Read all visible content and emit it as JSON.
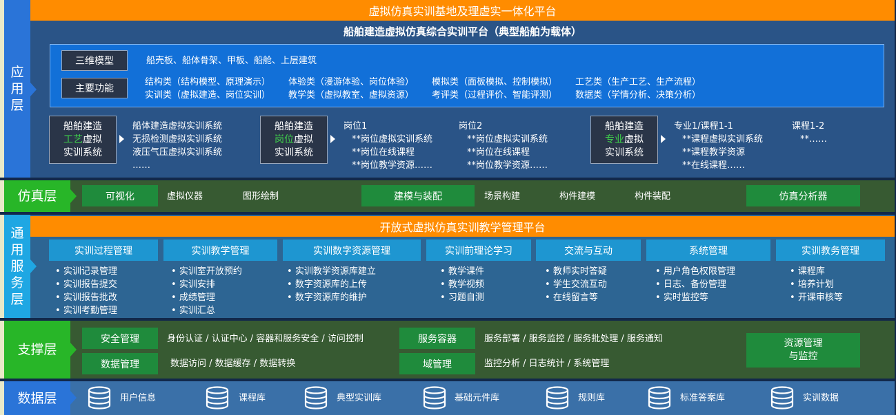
{
  "top_title": "虚拟仿真实训基地及理虚实一体化平台",
  "app_layer": {
    "side_label": "应\n用\n层",
    "subtitle": "船舶建造虚拟仿真综合实训平台（典型船舶为载体）",
    "model_label": "三维模型",
    "model_text": "船壳板、船体骨架、甲板、船舱、上层建筑",
    "func_label": "主要功能",
    "func_lines": [
      [
        "结构类（结构模型、原理演示）",
        "体验类（漫游体验、岗位体验）",
        "模拟类（面板模拟、控制模拟）",
        "工艺类（生产工艺、生产流程）"
      ],
      [
        "实训类（虚拟建造、岗位实训）",
        "教学类（虚拟教室、虚拟资源）",
        "考评类（过程评价、智能评测）",
        "数据类（学情分析、决策分析）"
      ]
    ],
    "systems": [
      {
        "l1": "船舶建造",
        "l2a": "工艺",
        "l2b": "虚拟",
        "l3": "实训系统",
        "items": [
          "船体建造虚拟实训系统",
          "无损检测虚拟实训系统",
          "液压气压虚拟实训系统",
          "……"
        ]
      },
      {
        "l1": "船舶建造",
        "l2a": "岗位",
        "l2b": "虚拟",
        "l3": "实训系统",
        "col1": [
          "岗位1",
          "**岗位虚拟实训系统",
          "**岗位在线课程",
          "**岗位教学资源……"
        ],
        "col2": [
          "岗位2",
          "**岗位虚拟实训系统",
          "**岗位在线课程",
          "**岗位教学资源……"
        ]
      },
      {
        "l1": "船舶建造",
        "l2a": "专业",
        "l2b": "虚拟",
        "l3": "实训系统",
        "col1": [
          "专业1/课程1-1",
          "**课程虚拟实训系统",
          "**课程教学资源",
          "**在线课程……"
        ],
        "col2": [
          "课程1-2",
          "**……"
        ]
      }
    ]
  },
  "sim_layer": {
    "side_label": "仿真层",
    "boxes": [
      "可视化",
      "建模与装配",
      "仿真分析器"
    ],
    "texts": [
      "虚拟仪器",
      "图形绘制",
      "场景构建",
      "构件建模",
      "构件装配"
    ]
  },
  "service_layer": {
    "side_label": "通\n用\n服\n务\n层",
    "title": "开放式虚拟仿真实训教学管理平台",
    "modules": [
      {
        "name": "实训过程管理",
        "items": [
          "实训记录管理",
          "实训报告提交",
          "实训报告批改",
          "实训考勤管理"
        ]
      },
      {
        "name": "实训教学管理",
        "items": [
          "实训室开放预约",
          "实训安排",
          "成绩管理",
          "实训汇总"
        ]
      },
      {
        "name": "实训数字资源管理",
        "items": [
          "实训教学资源库建立",
          "数字资源库的上传",
          "数字资源库的维护"
        ]
      },
      {
        "name": "实训前理论学习",
        "items": [
          "教学课件",
          "教学视频",
          "习题自测"
        ]
      },
      {
        "name": "交流与互动",
        "items": [
          "教师实时答疑",
          "学生交流互动",
          "在线留言等"
        ]
      },
      {
        "name": "系统管理",
        "items": [
          "用户角色权限管理",
          "日志、备份管理",
          "实时监控等"
        ]
      },
      {
        "name": "实训教务管理",
        "items": [
          "课程库",
          "培养计划",
          "开课审核等"
        ]
      }
    ]
  },
  "support_layer": {
    "side_label": "支撑层",
    "security": "安全管理",
    "security_text": "身份认证 / 认证中心 / 容器和服务安全 / 访问控制",
    "data_mgmt": "数据管理",
    "data_text": "数据访问 / 数据缓存 / 数据转换",
    "container": "服务容器",
    "container_text": "服务部署 / 服务监控 / 服务批处理 / 服务通知",
    "domain": "域管理",
    "domain_text": "监控分析 / 日志统计 / 系统管理",
    "resource_l1": "资源管理",
    "resource_l2": "与监控"
  },
  "data_layer": {
    "side_label": "数据层",
    "items": [
      "用户信息",
      "课程库",
      "典型实训库",
      "基础元件库",
      "规则库",
      "标准答案库",
      "实训数据"
    ]
  },
  "colors": {
    "orange": "#ff8c00",
    "green": "#1f8b3c",
    "blue": "#1e96d1",
    "panel": "#2a5487"
  }
}
